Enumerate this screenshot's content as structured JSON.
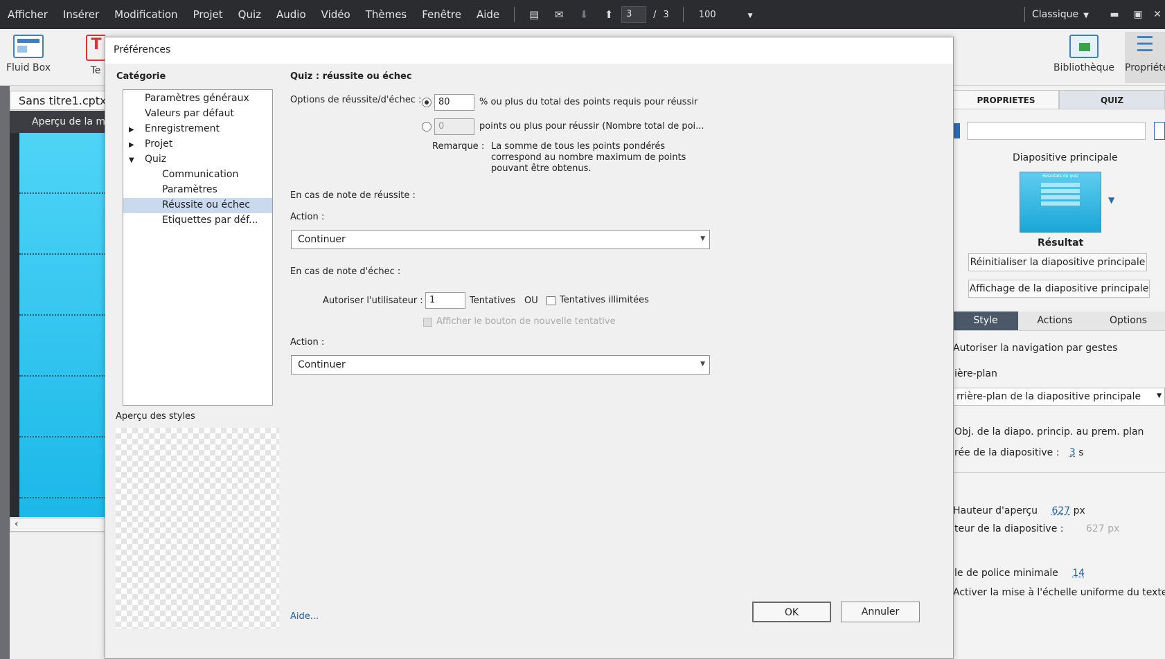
{
  "menubar": {
    "items": [
      "Afficher",
      "Insérer",
      "Modification",
      "Projet",
      "Quiz",
      "Audio",
      "Vidéo",
      "Thèmes",
      "Fenêtre",
      "Aide"
    ],
    "current_page": "3",
    "page_separator": "/",
    "total_pages": "3",
    "zoom": "100",
    "workspace": "Classique"
  },
  "toolbar": {
    "fluid_box": "Fluid Box",
    "text_partial": "Te",
    "library": "Bibliothèque",
    "properties": "Propriété"
  },
  "document": {
    "tab": "Sans titre1.cptx",
    "preview_header": "Aperçu de la mis"
  },
  "right_panel": {
    "tabs": [
      "PROPRIETES",
      "QUIZ"
    ],
    "master_slide_label": "Diapositive principale",
    "thumb_title": "Résultats du quiz",
    "thumb_caption": "Résultat",
    "reset_button": "Réinitialiser la diapositive principale",
    "show_button": "Affichage de la diapositive principale",
    "subtabs": [
      "Style",
      "Actions",
      "Options"
    ],
    "gesture_nav": "Autoriser la navigation par gestes",
    "background_label": "ière-plan",
    "background_select": "rrière-plan de la diapositive principale",
    "master_objects": "Obj. de la diapo. princip. au prem. plan",
    "duration_label": "rée de la diapositive :",
    "duration_value": "3",
    "duration_unit": "s",
    "preview_height_label": "Hauteur d'aperçu",
    "preview_height_value": "627",
    "preview_height_unit": "px",
    "slide_height_label": "teur de la diapositive :",
    "slide_height_value": "627",
    "slide_height_unit": "px",
    "min_font_label": "le de police minimale",
    "min_font_value": "14",
    "uniform_scale": "Activer la mise à l'échelle uniforme du texte"
  },
  "dialog": {
    "title": "Préférences",
    "category_heading": "Catégorie",
    "categories": [
      {
        "label": "Paramètres généraux",
        "expander": ""
      },
      {
        "label": "Valeurs par défaut",
        "expander": ""
      },
      {
        "label": "Enregistrement",
        "expander": "▶"
      },
      {
        "label": "Projet",
        "expander": "▶"
      },
      {
        "label": "Quiz",
        "expander": "▼"
      },
      {
        "label": "Communication",
        "expander": ""
      },
      {
        "label": "Paramètres",
        "expander": ""
      },
      {
        "label": "Réussite ou échec",
        "expander": ""
      },
      {
        "label": "Etiquettes par déf...",
        "expander": ""
      }
    ],
    "selected_category": "Réussite ou échec",
    "styles_preview_label": "Aperçu des styles",
    "help_link": "Aide...",
    "section_title": "Quiz : réussite ou échec",
    "pass_options_label": "Options de réussite/d'échec :",
    "percent_value": "80",
    "percent_text": "% ou plus du total des points requis pour réussir",
    "points_value": "0",
    "points_text": "points ou plus pour réussir (Nombre total de poi...",
    "note_label": "Remarque :",
    "note_lines": [
      "La somme de tous les points pondérés",
      "correspond au nombre maximum de points",
      "pouvant être obtenus."
    ],
    "on_pass_label": "En cas de note de réussite :",
    "action_label": "Action :",
    "pass_action": "Continuer",
    "on_fail_label": "En cas de note d'échec :",
    "allow_user_label": "Autoriser l'utilisateur :",
    "attempts_value": "1",
    "attempts_label": "Tentatives",
    "or_label": "OU",
    "unlimited_label": "Tentatives illimitées",
    "retry_button_label": "Afficher le bouton de nouvelle tentative",
    "fail_action_label": "Action :",
    "fail_action": "Continuer",
    "ok_button": "OK",
    "cancel_button": "Annuler"
  }
}
